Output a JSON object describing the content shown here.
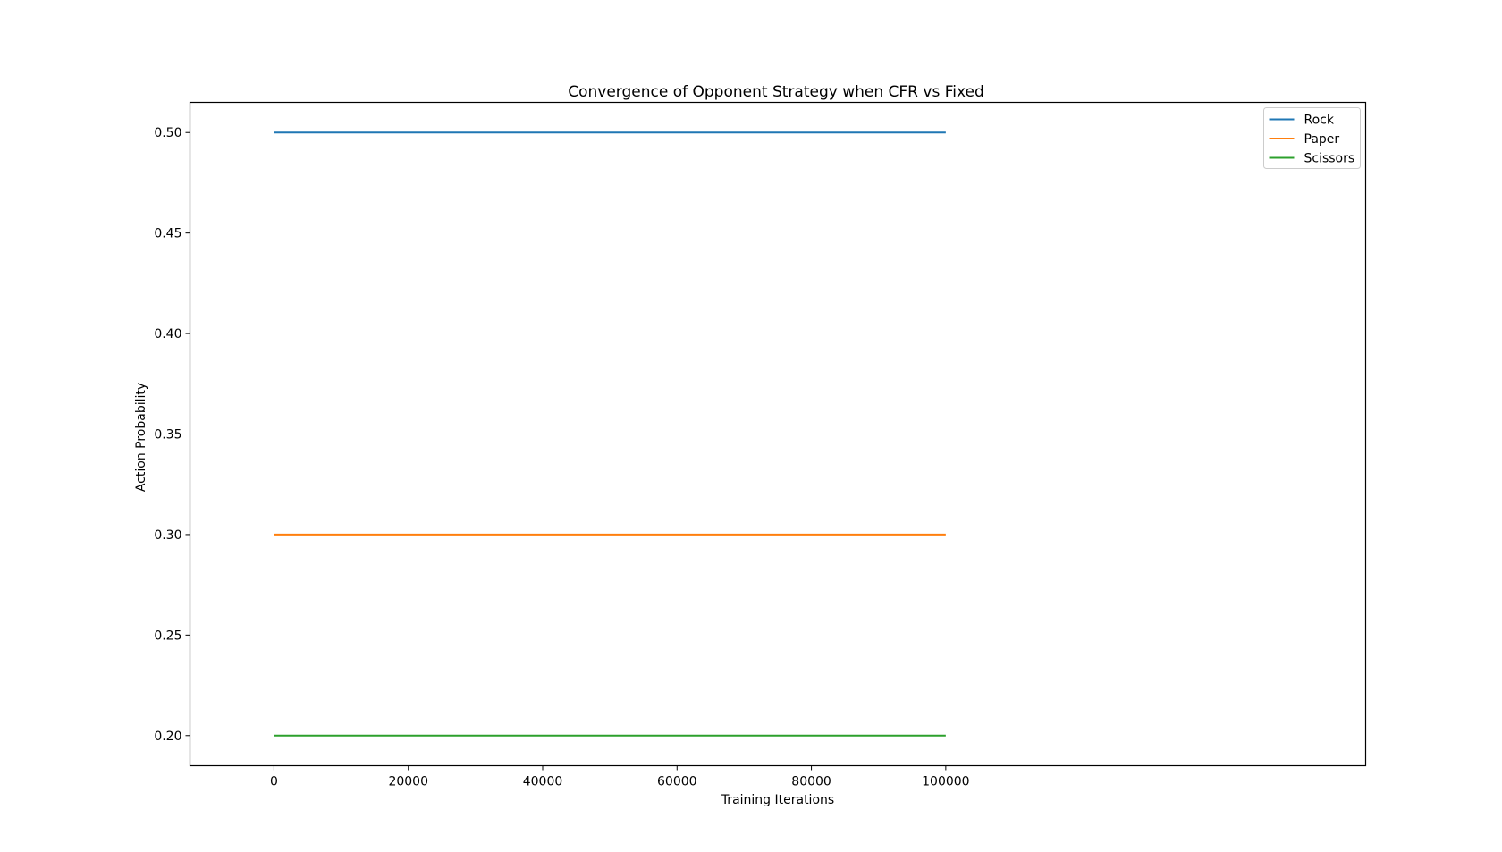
{
  "chart_data": {
    "type": "line",
    "title": "Convergence of Opponent Strategy when CFR vs Fixed",
    "xlabel": "Training Iterations",
    "ylabel": "Action Probability",
    "x": [
      0,
      100000
    ],
    "xlim": [
      -12500,
      162500
    ],
    "ylim": [
      0.185,
      0.515
    ],
    "xticks": [
      0,
      20000,
      40000,
      60000,
      80000,
      100000
    ],
    "yticks": [
      0.2,
      0.25,
      0.3,
      0.35,
      0.4,
      0.45,
      0.5
    ],
    "xtick_labels": [
      "0",
      "20000",
      "40000",
      "60000",
      "80000",
      "100000"
    ],
    "ytick_labels": [
      "0.20",
      "0.25",
      "0.30",
      "0.35",
      "0.40",
      "0.45",
      "0.50"
    ],
    "series": [
      {
        "name": "Rock",
        "color": "#1f77b4",
        "values": [
          0.5,
          0.5
        ]
      },
      {
        "name": "Paper",
        "color": "#ff7f0e",
        "values": [
          0.3,
          0.3
        ]
      },
      {
        "name": "Scissors",
        "color": "#2ca02c",
        "values": [
          0.2,
          0.2
        ]
      }
    ],
    "grid": false,
    "legend_placement": "upper right"
  }
}
